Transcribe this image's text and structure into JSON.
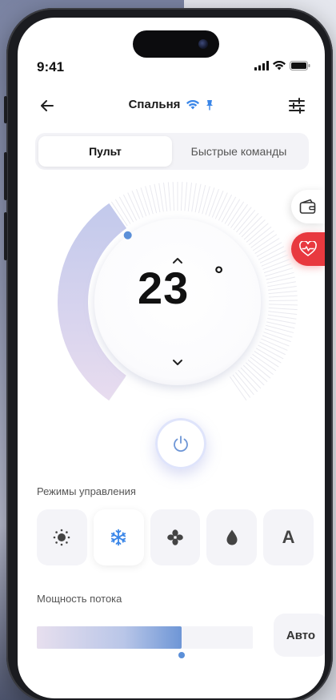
{
  "status_bar": {
    "time": "9:41"
  },
  "header": {
    "title": "Спальня"
  },
  "tabs": [
    {
      "label": "Пульт",
      "active": true
    },
    {
      "label": "Быстрые команды",
      "active": false
    }
  ],
  "climate": {
    "temperature": "23",
    "unit": "°",
    "dial_level": 0.38
  },
  "modes": {
    "label": "Режимы управления",
    "items": [
      {
        "name": "sun-icon",
        "active": false
      },
      {
        "name": "snowflake-icon",
        "active": true
      },
      {
        "name": "fan-icon",
        "active": false
      },
      {
        "name": "droplet-icon",
        "active": false
      },
      {
        "name": "auto-mode",
        "letter": "A",
        "active": false
      }
    ]
  },
  "flow": {
    "label": "Мощность потока",
    "level": 0.67,
    "auto_label": "Авто"
  },
  "colors": {
    "accent": "#5b8fd8",
    "alert": "#e8393f",
    "wifi": "#3a86e8"
  }
}
